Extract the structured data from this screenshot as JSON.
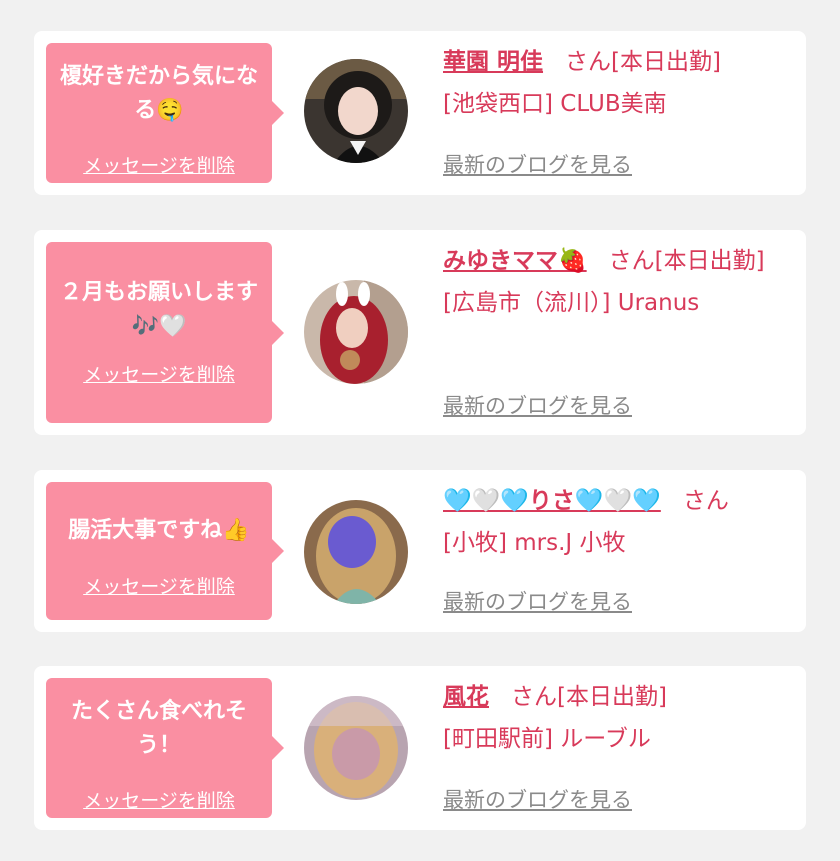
{
  "items": [
    {
      "message": "榎好きだから気になる🤤",
      "delete_label": "メッセージを削除",
      "name": "華園 明佳",
      "suffix": "さん[本日出勤]",
      "shop": "[池袋西口] CLUB美南",
      "blog_label": "最新のブログを見る"
    },
    {
      "message": "２月もお願いします🎶🤍",
      "delete_label": "メッセージを削除",
      "name": "みゆきママ🍓",
      "suffix": "さん[本日出勤]",
      "shop": "[広島市（流川）] Uranus",
      "blog_label": "最新のブログを見る"
    },
    {
      "message": "腸活大事ですね👍",
      "delete_label": "メッセージを削除",
      "name": "🩵🤍🩵りさ🩵🤍🩵",
      "suffix": "さん",
      "shop": "[小牧] mrs.J 小牧",
      "blog_label": "最新のブログを見る"
    },
    {
      "message": "たくさん食べれそう！",
      "delete_label": "メッセージを削除",
      "name": "風花",
      "suffix": "さん[本日出勤]",
      "shop": "[町田駅前] ルーブル",
      "blog_label": "最新のブログを見る"
    }
  ],
  "colors": {
    "accent": "#d83a5a",
    "bubble": "#fa8fa2",
    "link_gray": "#8a8a8a",
    "background": "#f1f1f1"
  }
}
